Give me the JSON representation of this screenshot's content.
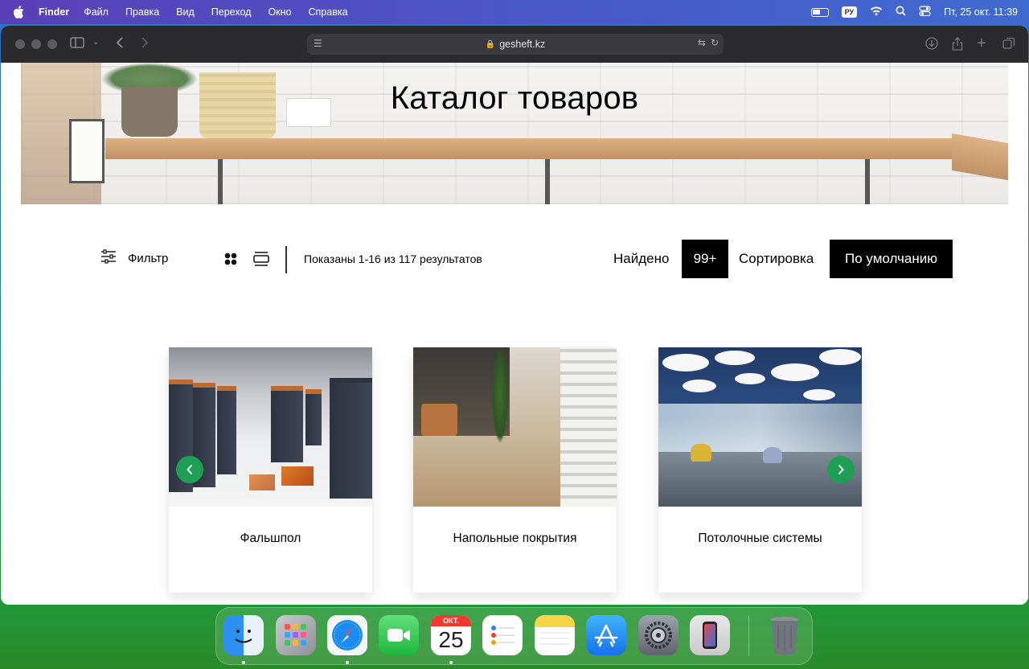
{
  "menubar": {
    "app_name": "Finder",
    "items": [
      "Файл",
      "Правка",
      "Вид",
      "Переход",
      "Окно",
      "Справка"
    ],
    "input_lang": "РУ",
    "datetime": "Пт, 25 окт.  11:39"
  },
  "browser": {
    "url": "gesheft.kz"
  },
  "page": {
    "hero_title": "Каталог товаров",
    "filter_label": "Фильтр",
    "results_text": "Показаны 1-16 из 117 результатов",
    "found_label": "Найдено",
    "found_count": "99+",
    "sort_label": "Сортировка",
    "sort_value": "По умолчанию",
    "products": [
      {
        "name": "Фальшпол"
      },
      {
        "name": "Напольные покрытия"
      },
      {
        "name": "Потолочные системы"
      }
    ],
    "accent_color": "#1f9e55"
  },
  "dock": {
    "calendar_month": "ОКТ.",
    "calendar_day": "25"
  }
}
